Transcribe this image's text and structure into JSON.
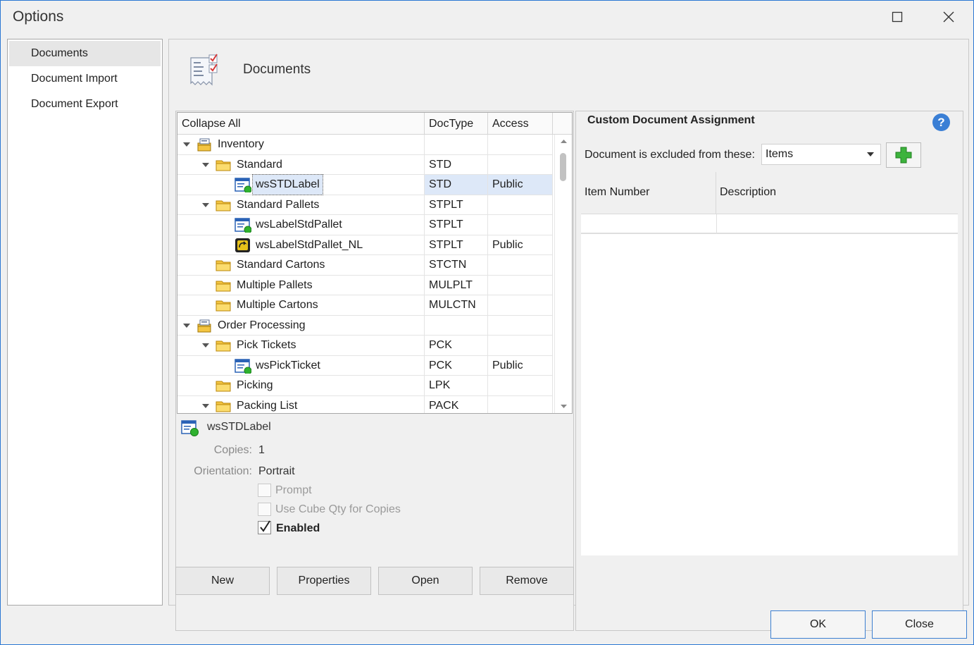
{
  "window": {
    "title": "Options"
  },
  "nav": {
    "items": [
      {
        "label": "Documents"
      },
      {
        "label": "Document Import"
      },
      {
        "label": "Document Export"
      }
    ]
  },
  "header": {
    "title": "Documents",
    "icon": "document-list-icon"
  },
  "tree": {
    "columns": {
      "name": "Collapse All",
      "doctype": "DocType",
      "access": "Access"
    },
    "rows": [
      {
        "label": "Inventory",
        "doctype": "",
        "access": "",
        "level": 0,
        "icon": "cabinet-folder-icon",
        "expanded": true
      },
      {
        "label": "Standard",
        "doctype": "STD",
        "access": "",
        "level": 1,
        "icon": "folder-icon",
        "expanded": true
      },
      {
        "label": "wsSTDLabel",
        "doctype": "STD",
        "access": "Public",
        "level": 2,
        "icon": "label-document-icon",
        "selected": true
      },
      {
        "label": "Standard Pallets",
        "doctype": "STPLT",
        "access": "",
        "level": 1,
        "icon": "folder-icon",
        "expanded": true
      },
      {
        "label": "wsLabelStdPallet",
        "doctype": "STPLT",
        "access": "",
        "level": 2,
        "icon": "label-document-icon"
      },
      {
        "label": "wsLabelStdPallet_NL",
        "doctype": "STPLT",
        "access": "Public",
        "level": 2,
        "icon": "linked-document-icon"
      },
      {
        "label": "Standard Cartons",
        "doctype": "STCTN",
        "access": "",
        "level": 1,
        "icon": "folder-icon"
      },
      {
        "label": "Multiple Pallets",
        "doctype": "MULPLT",
        "access": "",
        "level": 1,
        "icon": "folder-icon"
      },
      {
        "label": "Multiple Cartons",
        "doctype": "MULCTN",
        "access": "",
        "level": 1,
        "icon": "folder-icon"
      },
      {
        "label": "Order Processing",
        "doctype": "",
        "access": "",
        "level": 0,
        "icon": "cabinet-folder-icon",
        "expanded": true
      },
      {
        "label": "Pick Tickets",
        "doctype": "PCK",
        "access": "",
        "level": 1,
        "icon": "folder-icon",
        "expanded": true
      },
      {
        "label": "wsPickTicket",
        "doctype": "PCK",
        "access": "Public",
        "level": 2,
        "icon": "label-document-icon"
      },
      {
        "label": "Picking",
        "doctype": "LPK",
        "access": "",
        "level": 1,
        "icon": "folder-icon"
      },
      {
        "label": "Packing List",
        "doctype": "PACK",
        "access": "",
        "level": 1,
        "icon": "folder-icon",
        "expanded": true
      }
    ]
  },
  "details": {
    "name": "wsSTDLabel",
    "copies_label": "Copies:",
    "copies_value": "1",
    "orientation_label": "Orientation:",
    "orientation_value": "Portrait",
    "prompt_label": "Prompt",
    "prompt_checked": false,
    "cube_label": "Use Cube Qty  for Copies",
    "cube_checked": false,
    "enabled_label": "Enabled",
    "enabled_checked": true
  },
  "cda": {
    "title": "Custom Document Assignment",
    "excluded_label": "Document is excluded from these:",
    "combo_value": "Items",
    "col_item": "Item Number",
    "col_desc": "Description"
  },
  "buttons": {
    "new": "New",
    "properties": "Properties",
    "open": "Open",
    "remove": "Remove",
    "ok": "OK",
    "close": "Close"
  },
  "colors": {
    "accent": "#2b78d4",
    "selection": "#dde8f8",
    "help": "#3a7fd5",
    "add": "#3db33d"
  }
}
